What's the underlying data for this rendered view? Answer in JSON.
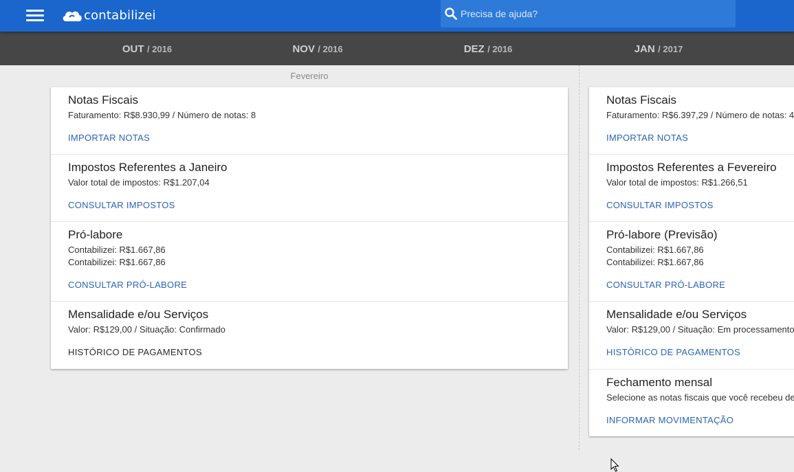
{
  "topbar": {
    "app_name": "contabilizei",
    "search_placeholder": "Precisa de ajuda?"
  },
  "months": [
    {
      "month": "OUT",
      "year": "/ 2016"
    },
    {
      "month": "NOV",
      "year": "/ 2016"
    },
    {
      "month": "DEZ",
      "year": "/ 2016"
    },
    {
      "month": "JAN",
      "year": "/ 2017"
    }
  ],
  "column_label": "Fevereiro",
  "left_card": {
    "notas": {
      "title": "Notas Fiscais",
      "line": "Faturamento: R$8.930,99 / Número de notas: 8",
      "link": "IMPORTAR NOTAS"
    },
    "impostos": {
      "title": "Impostos Referentes a Janeiro",
      "line": "Valor total de impostos: R$1.207,04",
      "link": "CONSULTAR IMPOSTOS"
    },
    "prolabore": {
      "title": "Pró-labore",
      "line1": "Contabilizei: R$1.667,86",
      "line2": "Contabilizei: R$1.667,86",
      "link": "CONSULTAR PRÓ-LABORE"
    },
    "mensalidade": {
      "title": "Mensalidade e/ou Serviços",
      "line": "Valor: R$129,00 / Situação: Confirmado",
      "link": "HISTÓRICO DE PAGAMENTOS"
    }
  },
  "right_card": {
    "notas": {
      "title": "Notas Fiscais",
      "line": "Faturamento: R$6.397,29 / Número de notas: 4",
      "link": "IMPORTAR NOTAS"
    },
    "impostos": {
      "title": "Impostos Referentes a Fevereiro",
      "line": "Valor total de impostos: R$1.266,51",
      "link": "CONSULTAR IMPOSTOS"
    },
    "prolabore": {
      "title": "Pró-labore (Previsão)",
      "line1": "Contabilizei: R$1.667,86",
      "line2": "Contabilizei: R$1.667,86",
      "link": "CONSULTAR PRÓ-LABORE"
    },
    "mensalidade": {
      "title": "Mensalidade e/ou Serviços",
      "line": "Valor: R$129,00 / Situação: Em processamento",
      "link": "HISTÓRICO DE PAGAMENTOS"
    },
    "fechamento": {
      "title": "Fechamento mensal",
      "line": "Selecione as notas fiscais que você recebeu de",
      "link": "INFORMAR MOVIMENTAÇÃO"
    }
  },
  "colors": {
    "topbar": "#1a66cc",
    "monthbar": "#464646",
    "link": "#2a63b8"
  }
}
